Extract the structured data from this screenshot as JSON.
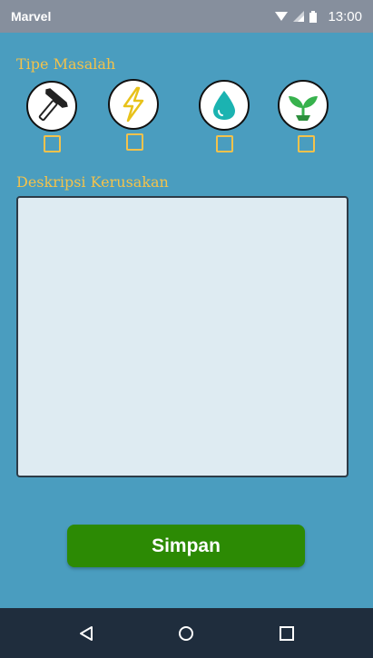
{
  "status_bar": {
    "carrier": "Marvel",
    "time": "13:00",
    "icons": [
      "wifi-icon",
      "signal-icon",
      "battery-icon"
    ]
  },
  "problem_type": {
    "label": "Tipe Masalah",
    "options": [
      {
        "icon": "hammer-icon",
        "checked": false
      },
      {
        "icon": "lightning-icon",
        "checked": false
      },
      {
        "icon": "water-drop-icon",
        "checked": false
      },
      {
        "icon": "plant-icon",
        "checked": false
      }
    ]
  },
  "description": {
    "label": "Deskripsi Kerusakan",
    "value": "",
    "placeholder": ""
  },
  "save_button": {
    "label": "Simpan"
  },
  "nav": {
    "icons": [
      "back-icon",
      "home-icon",
      "recents-icon"
    ]
  },
  "colors": {
    "background": "#4a9dbf",
    "accent_label": "#f3c24b",
    "button": "#2c8a04",
    "status_bar": "#868f9d",
    "nav_bar": "#1f2d3d"
  }
}
